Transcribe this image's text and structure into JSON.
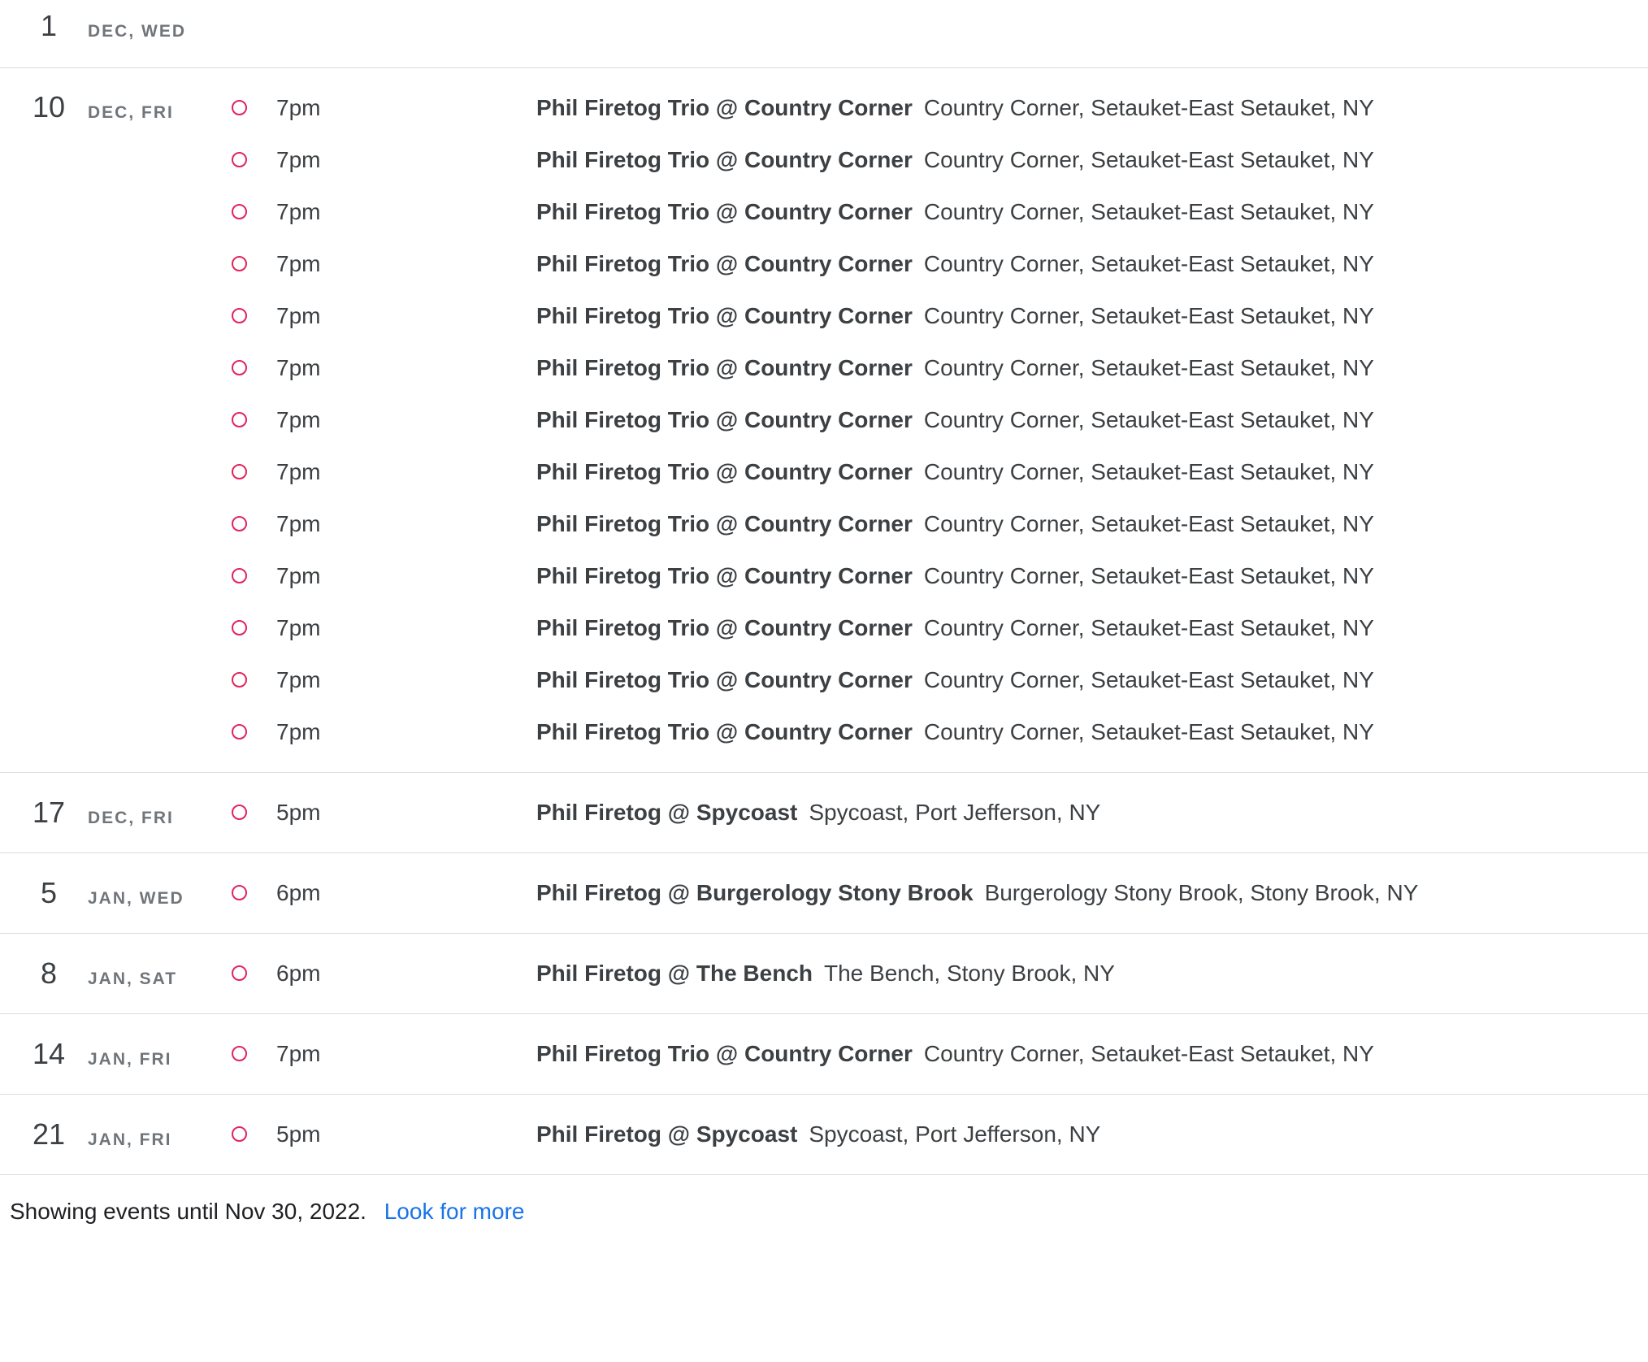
{
  "accent_color": "#e0245e",
  "days": [
    {
      "num": "1",
      "label": "DEC, WED",
      "events": []
    },
    {
      "num": "10",
      "label": "DEC, FRI",
      "events": [
        {
          "time": "7pm",
          "title": "Phil Firetog Trio @ Country Corner",
          "location": "Country Corner, Setauket-East Setauket, NY"
        },
        {
          "time": "7pm",
          "title": "Phil Firetog Trio @ Country Corner",
          "location": "Country Corner, Setauket-East Setauket, NY"
        },
        {
          "time": "7pm",
          "title": "Phil Firetog Trio @ Country Corner",
          "location": "Country Corner, Setauket-East Setauket, NY"
        },
        {
          "time": "7pm",
          "title": "Phil Firetog Trio @ Country Corner",
          "location": "Country Corner, Setauket-East Setauket, NY"
        },
        {
          "time": "7pm",
          "title": "Phil Firetog Trio @ Country Corner",
          "location": "Country Corner, Setauket-East Setauket, NY"
        },
        {
          "time": "7pm",
          "title": "Phil Firetog Trio @ Country Corner",
          "location": "Country Corner, Setauket-East Setauket, NY"
        },
        {
          "time": "7pm",
          "title": "Phil Firetog Trio @ Country Corner",
          "location": "Country Corner, Setauket-East Setauket, NY"
        },
        {
          "time": "7pm",
          "title": "Phil Firetog Trio @ Country Corner",
          "location": "Country Corner, Setauket-East Setauket, NY"
        },
        {
          "time": "7pm",
          "title": "Phil Firetog Trio @ Country Corner",
          "location": "Country Corner, Setauket-East Setauket, NY"
        },
        {
          "time": "7pm",
          "title": "Phil Firetog Trio @ Country Corner",
          "location": "Country Corner, Setauket-East Setauket, NY"
        },
        {
          "time": "7pm",
          "title": "Phil Firetog Trio @ Country Corner",
          "location": "Country Corner, Setauket-East Setauket, NY"
        },
        {
          "time": "7pm",
          "title": "Phil Firetog Trio @ Country Corner",
          "location": "Country Corner, Setauket-East Setauket, NY"
        },
        {
          "time": "7pm",
          "title": "Phil Firetog Trio @ Country Corner",
          "location": "Country Corner, Setauket-East Setauket, NY"
        }
      ]
    },
    {
      "num": "17",
      "label": "DEC, FRI",
      "events": [
        {
          "time": "5pm",
          "title": "Phil Firetog @ Spycoast",
          "location": "Spycoast, Port Jefferson, NY"
        }
      ]
    },
    {
      "num": "5",
      "label": "JAN, WED",
      "events": [
        {
          "time": "6pm",
          "title": "Phil Firetog @ Burgerology Stony Brook",
          "location": "Burgerology Stony Brook, Stony Brook, NY"
        }
      ]
    },
    {
      "num": "8",
      "label": "JAN, SAT",
      "events": [
        {
          "time": "6pm",
          "title": "Phil Firetog @ The Bench",
          "location": "The Bench, Stony Brook, NY"
        }
      ]
    },
    {
      "num": "14",
      "label": "JAN, FRI",
      "events": [
        {
          "time": "7pm",
          "title": "Phil Firetog Trio @ Country Corner",
          "location": "Country Corner, Setauket-East Setauket, NY"
        }
      ]
    },
    {
      "num": "21",
      "label": "JAN, FRI",
      "events": [
        {
          "time": "5pm",
          "title": "Phil Firetog @ Spycoast",
          "location": "Spycoast, Port Jefferson, NY"
        }
      ]
    }
  ],
  "footer": {
    "text": "Showing events until Nov 30, 2022.",
    "link": "Look for more"
  }
}
